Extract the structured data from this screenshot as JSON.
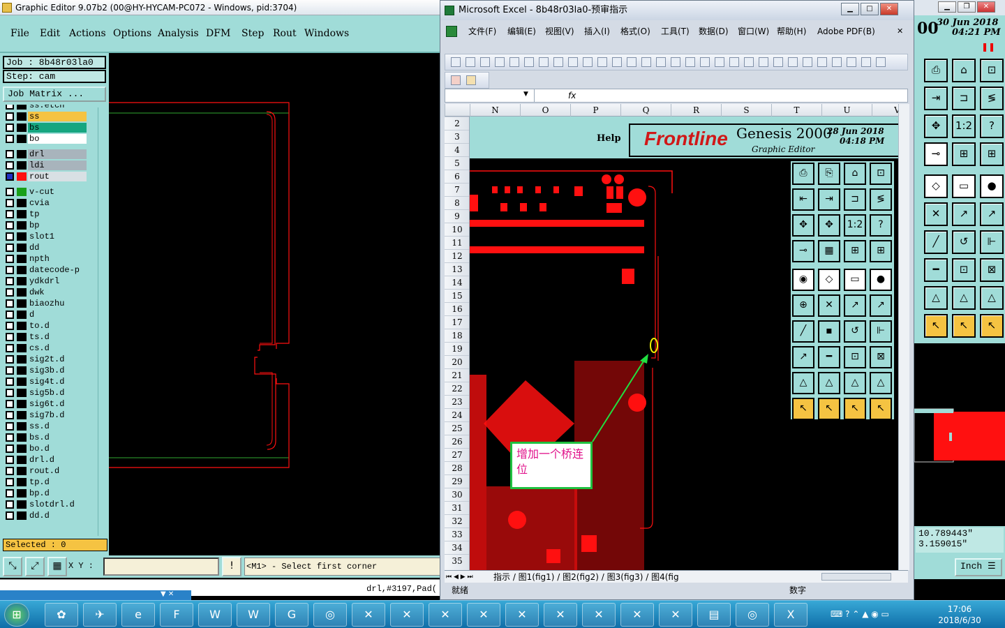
{
  "genesis": {
    "title": "Graphic Editor 9.07b2 (00@HY-HYCAM-PC072 - Windows, pid:3704)",
    "menu": [
      "File",
      "Edit",
      "Actions",
      "Options",
      "Analysis",
      "DFM",
      "Step",
      "Rout",
      "Windows"
    ],
    "job": "Job : 8b48r03la0",
    "step": "Step: cam",
    "job_matrix": "Job Matrix ...",
    "layers": [
      "ss.etch",
      "ss",
      "bs",
      "bo",
      "drl",
      "ldi",
      "rout",
      "v-cut",
      "cvia",
      "tp",
      "bp",
      "slot1",
      "dd",
      "npth",
      "datecode-p",
      "ydkdrl",
      "dwk",
      "biaozhu",
      "d",
      "to.d",
      "ts.d",
      "cs.d",
      "sig2t.d",
      "sig3b.d",
      "sig4t.d",
      "sig5b.d",
      "sig6t.d",
      "sig7b.d",
      "ss.d",
      "bs.d",
      "bo.d",
      "drl.d",
      "rout.d",
      "tp.d",
      "bp.d",
      "slotdrl.d",
      "dd.d"
    ],
    "selected": "Selected : 0",
    "xy_label": "X Y :",
    "message": "<M1> - Select first corner",
    "status": "drl,#3197,Pad(",
    "date": "30 Jun 2018",
    "time": "04:21 PM",
    "coord_x": "10.789443\"",
    "coord_y": "3.159015\"",
    "units": "Inch",
    "right_label": "00"
  },
  "excel": {
    "title": "Microsoft Excel - 8b48r03la0-预审指示",
    "menu": [
      "文件(F)",
      "编辑(E)",
      "视图(V)",
      "插入(I)",
      "格式(O)",
      "工具(T)",
      "数据(D)",
      "窗口(W)",
      "帮助(H)",
      "Adobe PDF(B)"
    ],
    "fx": "fx",
    "columns": [
      "N",
      "O",
      "P",
      "Q",
      "R",
      "S",
      "T",
      "U",
      "V"
    ],
    "rows": [
      "2",
      "3",
      "4",
      "5",
      "6",
      "7",
      "8",
      "9",
      "10",
      "11",
      "12",
      "13",
      "14",
      "15",
      "16",
      "17",
      "18",
      "19",
      "20",
      "21",
      "22",
      "23",
      "24",
      "25",
      "26",
      "27",
      "28",
      "29",
      "30",
      "31",
      "32",
      "33",
      "34",
      "35"
    ],
    "tabs": "指示 / 图1(fig1) / 图2(fig2) / 图3(fig3) / 图4(fig",
    "status_ready": "就绪",
    "status_num": "数字",
    "picture": {
      "help": "Help",
      "brand": "Frontline",
      "product": "Genesis 2000",
      "subtitle": "Graphic Editor",
      "date": "28 Jun 2018",
      "time": "04:18 PM",
      "callout": "增加一个桥连位"
    }
  },
  "taskbar": {
    "time": "17:06",
    "date": "2018/6/30"
  },
  "colors": {
    "genesis_teal": "#a0dcd8",
    "pcb_red": "#ff0000",
    "accent_yellow": "#f5c342",
    "callout_green": "#20c040",
    "callout_text": "#e0108a"
  }
}
